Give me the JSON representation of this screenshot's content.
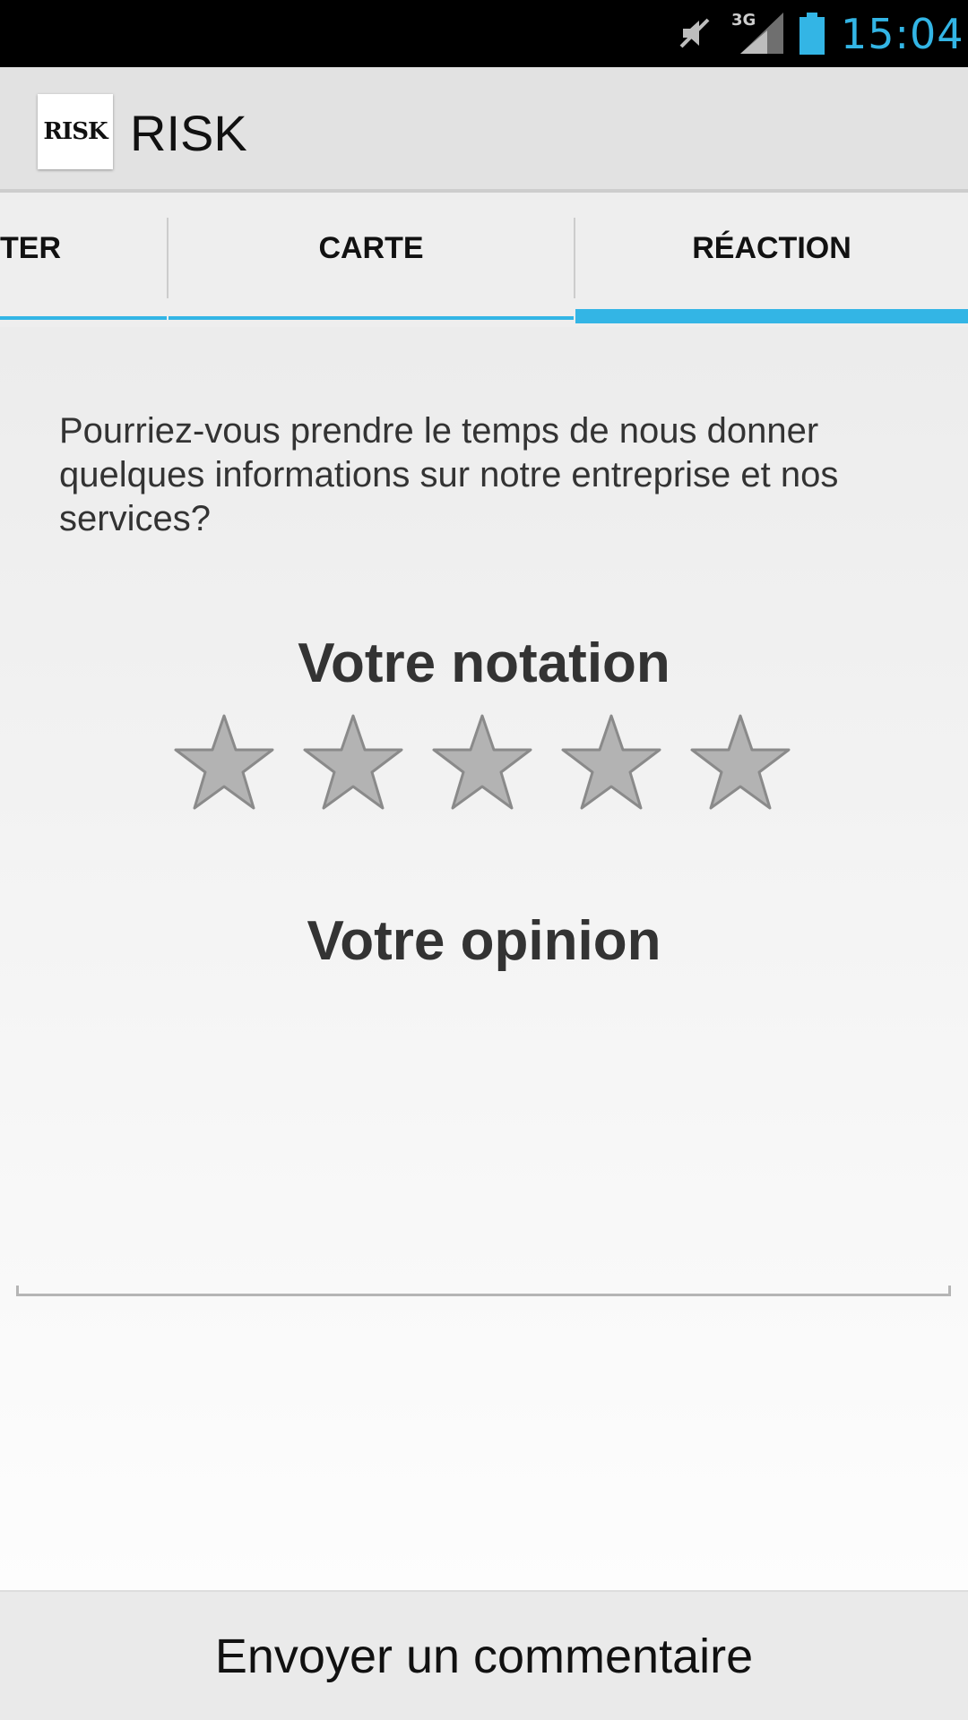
{
  "status_bar": {
    "time": "15:04",
    "network_type": "3G",
    "icons": [
      "mute-icon",
      "signal-icon",
      "battery-icon"
    ],
    "clock_color": "#33b5e5"
  },
  "action_bar": {
    "logo_text": "RISK",
    "title": "RISK"
  },
  "tabs": [
    {
      "label": "TER",
      "active": false
    },
    {
      "label": "CARTE",
      "active": false
    },
    {
      "label": "RÉACTION",
      "active": true
    }
  ],
  "accent_color": "#33b5e5",
  "feedback": {
    "intro": "Pourriez-vous prendre le temps de nous donner quelques informations sur notre entreprise et nos services?",
    "rating_title": "Votre notation",
    "rating": {
      "value": 0,
      "max": 5
    },
    "opinion_title": "Votre opinion",
    "opinion_value": "",
    "submit_label": "Envoyer un commentaire"
  }
}
